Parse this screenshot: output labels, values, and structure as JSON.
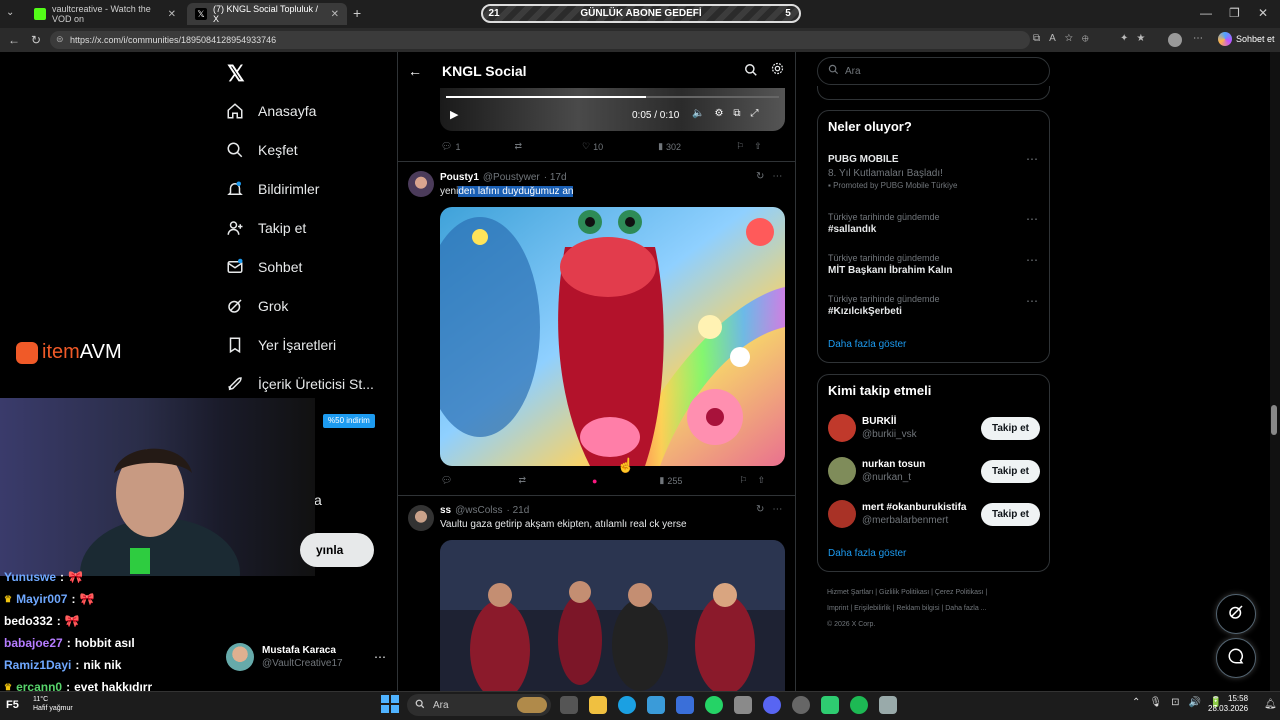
{
  "browser": {
    "tabs": [
      {
        "label": "vaultcreative - Watch the VOD on",
        "favicon_color": "#53fc18"
      },
      {
        "label": "(7) KNGL Social Topluluk / X",
        "favicon_color": "#ffffff"
      }
    ],
    "goal": {
      "left": "21",
      "label": "GÜNLÜK ABONE GEDEFİ",
      "right": "5"
    },
    "url": "https://x.com/i/communities/1895084128954933746",
    "sohbet_label": "Sohbet et"
  },
  "nav": {
    "items": [
      {
        "label": "Anasayfa",
        "icon": "home-icon"
      },
      {
        "label": "Keşfet",
        "icon": "search-icon"
      },
      {
        "label": "Bildirimler",
        "icon": "bell-icon"
      },
      {
        "label": "Takip et",
        "icon": "follow-icon"
      },
      {
        "label": "Sohbet",
        "icon": "mail-icon"
      },
      {
        "label": "Grok",
        "icon": "grok-icon"
      },
      {
        "label": "Yer İşaretleri",
        "icon": "bookmark-icon"
      },
      {
        "label": "İçerik Üreticisi St...",
        "icon": "rocket-icon"
      }
    ],
    "discount": "%50 indirim",
    "partial_label": "a",
    "publish_label": "yınla",
    "profile": {
      "name": "Mustafa Karaca",
      "handle": "@VaultCreative17"
    }
  },
  "overlay": {
    "itemavm_item": "item",
    "itemavm_avm": "AVM"
  },
  "chat": [
    {
      "user": "Yunuswe",
      "msg": "🎀",
      "color": "#6fa8ff"
    },
    {
      "user": "Mayir007",
      "msg": "🎀",
      "color": "#6fa8ff"
    },
    {
      "user": "bedo332",
      "msg": "🎀",
      "color": "#ffffff"
    },
    {
      "user": "babajoe27",
      "msg": "hobbit asıl",
      "color": "#b57cff"
    },
    {
      "user": "Ramiz1Dayi",
      "msg": "nik nik",
      "color": "#6fa8ff"
    },
    {
      "user": "ercann0",
      "msg": "evet hakkıdırr",
      "color": "#57d36b"
    }
  ],
  "center": {
    "title": "KNGL Social",
    "video": {
      "time": "0:05 / 0:10",
      "progress": 0.6
    },
    "tweet0_actions": {
      "replies": "1",
      "likes": "10",
      "views": "302"
    },
    "tweet1": {
      "name": "Pousty1",
      "handle": "@Poustywer",
      "age": "· 17d",
      "text_pre": "yeni",
      "text_selected": "den lafını duyduğumuz an",
      "views": "255"
    },
    "tweet2": {
      "name": "ss",
      "handle": "@wsColss",
      "age": "· 21d",
      "text": "Vaultu gaza getirip akşam ekipten, atılamlı real ck yerse"
    }
  },
  "right": {
    "search_placeholder": "Ara",
    "trends_title": "Neler oluyor?",
    "trends": [
      {
        "context": "PUBG MOBILE",
        "title": "8. Yıl Kutlamaları Başladı!",
        "promo": "Promoted by PUBG Mobile Türkiye"
      },
      {
        "context": "Türkiye tarihinde gündemde",
        "title": "#sallandık"
      },
      {
        "context": "Türkiye tarihinde gündemde",
        "title": "MİT Başkanı İbrahim Kalın"
      },
      {
        "context": "Türkiye tarihinde gündemde",
        "title": "#KızılcıkŞerbeti"
      }
    ],
    "show_more": "Daha fazla göster",
    "follow_title": "Kimi takip etmeli",
    "follow": [
      {
        "name": "BURKİİ",
        "handle": "@burkii_vsk",
        "color": "#c0392b"
      },
      {
        "name": "nurkan tosun",
        "handle": "@nurkan_t",
        "color": "#7f8c5a"
      },
      {
        "name": "mert #okanburukistifa",
        "handle": "@merbalarbenmert",
        "color": "#a93226"
      }
    ],
    "follow_button": "Takip et",
    "follow_more": "Daha fazla göster",
    "footer": {
      "l1": "Hizmet Şartları  |  Gizlilik Politikası  |  Çerez Politikası  |",
      "l2": "Imprint  |  Erişilebilirlik  |  Reklam bilgisi  |  Daha fazla ...",
      "l3": "© 2026 X Corp."
    }
  },
  "taskbar": {
    "search": "Ara",
    "weather_temp": "11°C",
    "weather_desc": "Hafif yağmur",
    "time": "15:58",
    "date": "28.03.2026",
    "f5": "F5"
  }
}
